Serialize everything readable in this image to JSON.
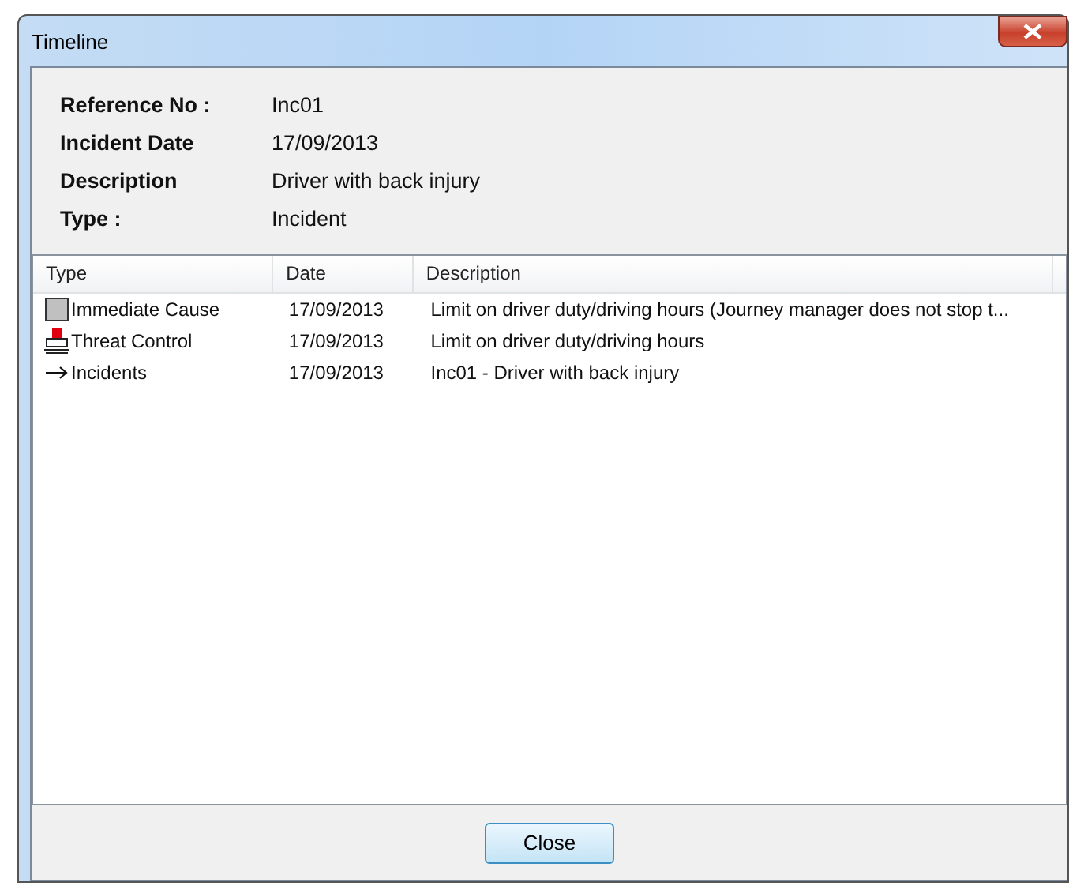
{
  "window": {
    "title": "Timeline"
  },
  "details": [
    {
      "label": "Reference No :",
      "value": "Inc01"
    },
    {
      "label": "Incident Date",
      "value": "17/09/2013"
    },
    {
      "label": "Description",
      "value": "Driver with back injury"
    },
    {
      "label": "Type :",
      "value": "Incident"
    }
  ],
  "table": {
    "columns": [
      "Type",
      "Date",
      "Description"
    ],
    "rows": [
      {
        "kind": "immediate-cause",
        "type": "Immediate Cause",
        "date": "17/09/2013",
        "description": "Limit on driver duty/driving hours (Journey manager does not stop t..."
      },
      {
        "kind": "threat-control",
        "type": "Threat Control",
        "date": "17/09/2013",
        "description": "Limit on driver duty/driving hours"
      },
      {
        "kind": "incident",
        "type": "Incidents",
        "date": "17/09/2013",
        "description": "Inc01 - Driver with back injury"
      }
    ]
  },
  "buttons": [
    "Close"
  ]
}
